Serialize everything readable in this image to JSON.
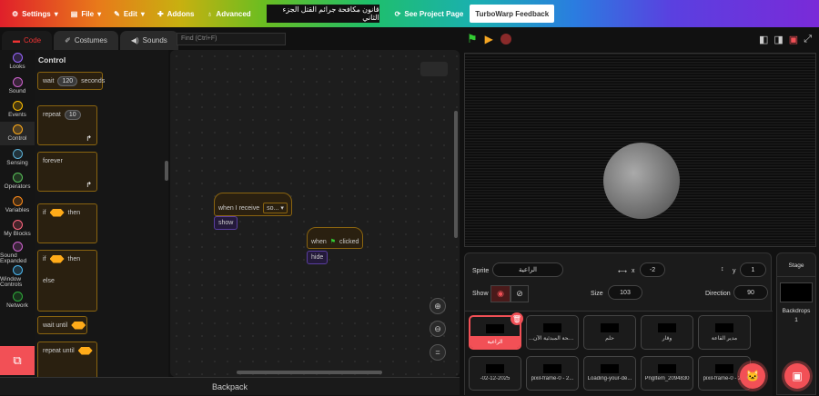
{
  "menu": {
    "settings": "Settings",
    "file": "File",
    "edit": "Edit",
    "addons": "Addons",
    "advanced": "Advanced",
    "project_title": "قانون مكافحة جرائم القتل الجزء الثاني",
    "see_project": "See Project Page",
    "feedback": "TurboWarp Feedback"
  },
  "tabs": {
    "code": "Code",
    "costumes": "Costumes",
    "sounds": "Sounds"
  },
  "find_placeholder": "Find (Ctrl+F)",
  "categories": [
    {
      "label": "Looks",
      "color": "#9966ff"
    },
    {
      "label": "Sound",
      "color": "#cf63cf"
    },
    {
      "label": "Events",
      "color": "#ffbf00"
    },
    {
      "label": "Control",
      "color": "#ffab19"
    },
    {
      "label": "Sensing",
      "color": "#5cb1d6"
    },
    {
      "label": "Operators",
      "color": "#59c059"
    },
    {
      "label": "Variables",
      "color": "#ff8c1a"
    },
    {
      "label": "My Blocks",
      "color": "#ff6680"
    },
    {
      "label": "Sound Expanded",
      "color": "#cf63cf"
    },
    {
      "label": "Window Controls",
      "color": "#4cb8f0"
    },
    {
      "label": "Network",
      "color": "#2eab3a"
    }
  ],
  "palette": {
    "title": "Control",
    "wait": "wait",
    "wait_value": "120",
    "seconds": "seconds",
    "repeat": "repeat",
    "repeat_value": "10",
    "forever": "forever",
    "if": "if",
    "then": "then",
    "else": "else",
    "wait_until": "wait until",
    "repeat_until": "repeat until"
  },
  "workspace": {
    "when_receive": "when I receive",
    "receive_value": "so...",
    "show": "show",
    "when": "when",
    "clicked": "clicked",
    "hide": "hide"
  },
  "backpack": "Backpack",
  "sprite_info": {
    "sprite_label": "Sprite",
    "sprite_name": "الراعية",
    "x_label": "x",
    "x": "-2",
    "y_label": "y",
    "y": "1",
    "show_label": "Show",
    "size_label": "Size",
    "size": "103",
    "direction_label": "Direction",
    "direction": "90"
  },
  "sprites": [
    "الراعية",
    "...ل الصحة المبدئية الآن",
    "حلم",
    "وقار",
    "مدير القاعة",
    "-02-12-2025",
    "pixil-frame-0 - 2...",
    "Loading-your-de...",
    "PngItem_2094830",
    "pixil-frame-0 - 2..."
  ],
  "stage_pane": {
    "title": "Stage",
    "backdrops_label": "Backdrops",
    "backdrops": "1"
  },
  "colors": {
    "accent": "#f25056",
    "control": "#ffab19"
  }
}
